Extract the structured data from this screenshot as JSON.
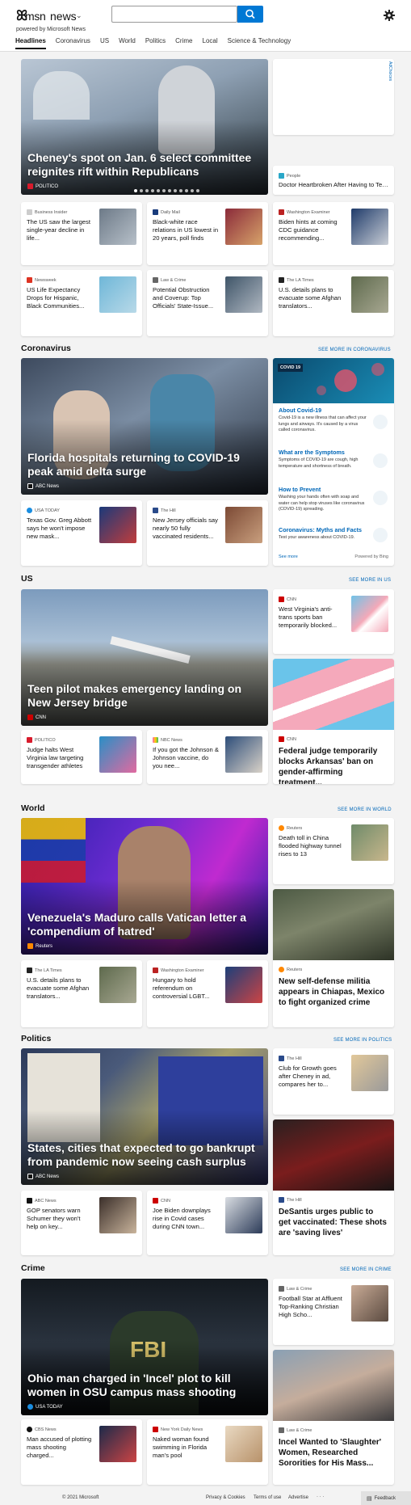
{
  "brand": {
    "logo": "msn",
    "app": "news",
    "powered": "powered by Microsoft News"
  },
  "search": {
    "placeholder": ""
  },
  "nav": [
    "Headlines",
    "Coronavirus",
    "US",
    "World",
    "Politics",
    "Crime",
    "Local",
    "Science & Technology"
  ],
  "top": {
    "hero": {
      "title": "Cheney's spot on Jan. 6 select committee reignites rift within Republicans",
      "source": "POLITICO"
    },
    "ad": {
      "label": "AdChoices"
    },
    "side": {
      "source": "People",
      "title": "Doctor Heartbroken After Having to Tell..."
    },
    "row1": [
      {
        "source": "Business Insider",
        "title": "The US saw the largest single-year decline in life..."
      },
      {
        "source": "Daily Mail",
        "title": "Black-white race relations in US lowest in 20 years, poll finds"
      },
      {
        "source": "Washington Examiner",
        "title": "Biden hints at coming CDC guidance recommending..."
      }
    ],
    "row2": [
      {
        "source": "Newsweek",
        "title": "US Life Expectancy Drops for Hispanic, Black Communities..."
      },
      {
        "source": "Law & Crime",
        "title": "Potential Obstruction and Coverup: Top Officials' State-Issue..."
      },
      {
        "source": "The LA Times",
        "title": "U.S. details plans to evacuate some Afghan translators..."
      }
    ]
  },
  "coronavirus": {
    "header": "Coronavirus",
    "see_more": "SEE MORE IN CORONAVIRUS",
    "hero": {
      "title": "Florida hospitals returning to COVID-19 peak amid delta surge",
      "source": "ABC News"
    },
    "cards": [
      {
        "source": "USA TODAY",
        "title": "Texas Gov. Greg Abbott says he won't impose new mask..."
      },
      {
        "source": "The Hill",
        "title": "New Jersey officials say nearly 50 fully vaccinated residents..."
      }
    ],
    "widget": {
      "tag": "COVID 19",
      "items": [
        {
          "title": "About Covid-19",
          "text": "Covid-19 is a new illness that can affect your lungs and airways. It's caused by a virus called coronavirus."
        },
        {
          "title": "What are the Symptoms",
          "text": "Symptoms of COVID-19 are cough, high temperature and shortness of breath."
        },
        {
          "title": "How to Prevent",
          "text": "Washing your hands often with soap and water can help stop viruses like coronavirus (COVID-19) spreading."
        },
        {
          "title": "Coronavirus: Myths and Facts",
          "text": "Test your awareness about COVID-19."
        }
      ],
      "see_more": "See more",
      "powered": "Powered by Bing"
    }
  },
  "us": {
    "header": "US",
    "see_more": "SEE MORE IN US",
    "hero": {
      "title": "Teen pilot makes emergency landing on New Jersey bridge",
      "source": "CNN"
    },
    "side": {
      "source": "CNN",
      "title": "West Virginia's anti-trans sports ban temporarily blocked..."
    },
    "tall": {
      "source": "CNN",
      "title": "Federal judge temporarily blocks Arkansas' ban on gender-affirming treatment..."
    },
    "cards": [
      {
        "source": "POLITICO",
        "title": "Judge halts West Virginia law targeting transgender athletes"
      },
      {
        "source": "NBC News",
        "title": "If you got the Johnson & Johnson vaccine, do you nee..."
      }
    ]
  },
  "world": {
    "header": "World",
    "see_more": "SEE MORE IN WORLD",
    "hero": {
      "title": "Venezuela's Maduro calls Vatican letter a 'compendium of hatred'",
      "source": "Reuters"
    },
    "side": {
      "source": "Reuters",
      "title": "Death toll in China flooded highway tunnel rises to 13"
    },
    "tall": {
      "source": "Reuters",
      "title": "New self-defense militia appears in Chiapas, Mexico to fight organized crime"
    },
    "cards": [
      {
        "source": "The LA Times",
        "title": "U.S. details plans to evacuate some Afghan translators..."
      },
      {
        "source": "Washington Examiner",
        "title": "Hungary to hold referendum on controversial LGBT..."
      }
    ]
  },
  "politics": {
    "header": "Politics",
    "see_more": "SEE MORE IN POLITICS",
    "hero": {
      "title": "States, cities that expected to go bankrupt from pandemic now seeing cash surplus",
      "source": "ABC News"
    },
    "side": {
      "source": "The Hill",
      "title": "Club for Growth goes after Cheney in ad, compares her to..."
    },
    "tall": {
      "source": "The Hill",
      "title": "DeSantis urges public to get vaccinated: These shots are 'saving lives'"
    },
    "cards": [
      {
        "source": "ABC News",
        "title": "GOP senators warn Schumer they won't help on key..."
      },
      {
        "source": "CNN",
        "title": "Joe Biden downplays rise in Covid cases during CNN town..."
      }
    ]
  },
  "crime": {
    "header": "Crime",
    "see_more": "SEE MORE IN CRIME",
    "hero": {
      "title": "Ohio man charged in 'Incel' plot to kill women in OSU campus mass shooting",
      "source": "USA TODAY"
    },
    "side": {
      "source": "Law & Crime",
      "title": "Football Star at Affluent Top-Ranking Christian High Scho..."
    },
    "tall": {
      "source": "Law & Crime",
      "title": "Incel Wanted to 'Slaughter' Women, Researched Sororities for His Mass..."
    },
    "cards": [
      {
        "source": "CBS News",
        "title": "Man accused of plotting mass shooting charged..."
      },
      {
        "source": "New York Daily News",
        "title": "Naked woman found swimming in Florida man's pool"
      }
    ]
  },
  "footer": {
    "copyright": "© 2021 Microsoft",
    "privacy": "Privacy & Cookies",
    "terms": "Terms of use",
    "advertise": "Advertise",
    "more": "· · ·",
    "feedback": "Feedback"
  },
  "colors": {
    "accent": "#0078d4",
    "link": "#0067b8"
  }
}
